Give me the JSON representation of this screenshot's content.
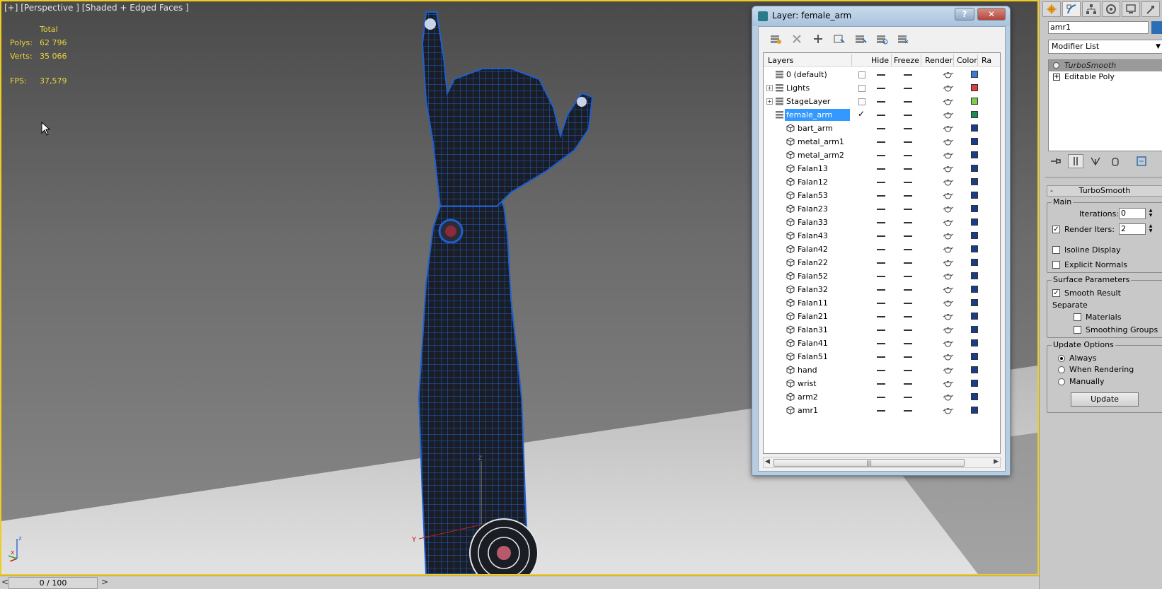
{
  "viewport": {
    "label": "[+] [Perspective ] [Shaded + Edged Faces ]",
    "stats": {
      "total_label": "Total",
      "polys_label": "Polys:",
      "polys_value": "62 796",
      "verts_label": "Verts:",
      "verts_value": "35 066",
      "fps_label": "FPS:",
      "fps_value": "37,579"
    },
    "axis_labels": {
      "x": "x",
      "y": "Y",
      "z": "z",
      "small_x": "x",
      "small_z": "z"
    }
  },
  "timeline": {
    "prev": "<",
    "frame": "0 / 100",
    "next": ">"
  },
  "layer_dialog": {
    "title": "Layer: female_arm",
    "help": "?",
    "close": "✕",
    "columns": {
      "layers": "Layers",
      "hide": "Hide",
      "freeze": "Freeze",
      "render": "Render",
      "color": "Color",
      "radiosity": "Ra"
    },
    "rows": [
      {
        "name": "0 (default)",
        "type": "layer",
        "color": "#3a7bd5",
        "checkbox": true
      },
      {
        "name": "Lights",
        "type": "layer",
        "color": "#d94040",
        "checkbox": true,
        "expander": "+"
      },
      {
        "name": "StageLayer",
        "type": "layer",
        "color": "#7ad04a",
        "checkbox": true,
        "expander": "+"
      },
      {
        "name": "female_arm",
        "type": "layer",
        "color": "#1f8a5a",
        "selected": true,
        "current": true
      },
      {
        "name": "bart_arm",
        "type": "object",
        "color": "#1a3d8a"
      },
      {
        "name": "metal_arm1",
        "type": "object",
        "color": "#1a3d8a"
      },
      {
        "name": "metal_arm2",
        "type": "object",
        "color": "#1a3d8a"
      },
      {
        "name": "Falan13",
        "type": "object",
        "color": "#1a3d8a"
      },
      {
        "name": "Falan12",
        "type": "object",
        "color": "#1a3d8a"
      },
      {
        "name": "Falan53",
        "type": "object",
        "color": "#1a3d8a"
      },
      {
        "name": "Falan23",
        "type": "object",
        "color": "#1a3d8a"
      },
      {
        "name": "Falan33",
        "type": "object",
        "color": "#1a3d8a"
      },
      {
        "name": "Falan43",
        "type": "object",
        "color": "#1a3d8a"
      },
      {
        "name": "Falan42",
        "type": "object",
        "color": "#1a3d8a"
      },
      {
        "name": "Falan22",
        "type": "object",
        "color": "#1a3d8a"
      },
      {
        "name": "Falan52",
        "type": "object",
        "color": "#1a3d8a"
      },
      {
        "name": "Falan32",
        "type": "object",
        "color": "#1a3d8a"
      },
      {
        "name": "Falan11",
        "type": "object",
        "color": "#1a3d8a"
      },
      {
        "name": "Falan21",
        "type": "object",
        "color": "#1a3d8a"
      },
      {
        "name": "Falan31",
        "type": "object",
        "color": "#1a3d8a"
      },
      {
        "name": "Falan41",
        "type": "object",
        "color": "#1a3d8a"
      },
      {
        "name": "Falan51",
        "type": "object",
        "color": "#1a3d8a"
      },
      {
        "name": "hand",
        "type": "object",
        "color": "#1a3d8a"
      },
      {
        "name": "wrist",
        "type": "object",
        "color": "#1a3d8a"
      },
      {
        "name": "arm2",
        "type": "object",
        "color": "#1a3d8a"
      },
      {
        "name": "amr1",
        "type": "object",
        "color": "#1a3d8a"
      }
    ]
  },
  "command_panel": {
    "object_name": "amr1",
    "object_color": "#2a6fb5",
    "modifier_list": "Modifier List",
    "stack": [
      {
        "label": "TurboSmooth",
        "active": true
      },
      {
        "label": "Editable Poly",
        "active": false
      }
    ],
    "rollout": {
      "title": "TurboSmooth",
      "collapse": "-",
      "main_group": "Main",
      "iterations_label": "Iterations:",
      "iterations_value": "0",
      "render_iters_label": "Render Iters:",
      "render_iters_value": "2",
      "render_iters_checked": true,
      "isoline_label": "Isoline Display",
      "explicit_normals_label": "Explicit Normals",
      "surface_group": "Surface Parameters",
      "smooth_result_label": "Smooth Result",
      "separate_label": "Separate",
      "materials_label": "Materials",
      "smoothing_groups_label": "Smoothing Groups",
      "update_group": "Update Options",
      "always_label": "Always",
      "when_rendering_label": "When Rendering",
      "manually_label": "Manually",
      "update_button": "Update"
    }
  }
}
